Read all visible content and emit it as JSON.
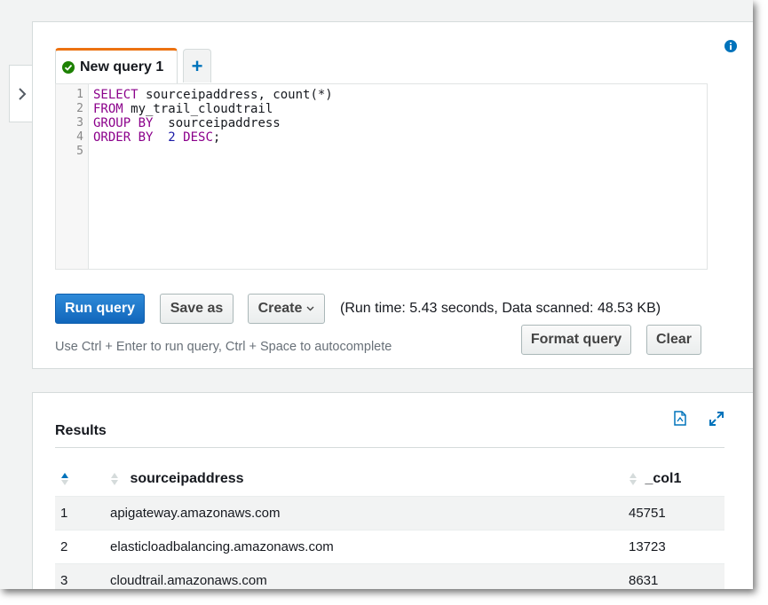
{
  "tab": {
    "label": "New query 1",
    "add_label": "+"
  },
  "editor": {
    "lines": [
      {
        "num": "1",
        "tokens": [
          {
            "t": "SELECT",
            "k": "kw"
          },
          {
            "t": " sourceipaddress, count(*)",
            "k": ""
          }
        ]
      },
      {
        "num": "2",
        "tokens": [
          {
            "t": "FROM",
            "k": "kw"
          },
          {
            "t": " my_trail_cloudtrail",
            "k": ""
          }
        ]
      },
      {
        "num": "3",
        "tokens": [
          {
            "t": "GROUP BY",
            "k": "kw"
          },
          {
            "t": "  sourceipaddress",
            "k": ""
          }
        ]
      },
      {
        "num": "4",
        "tokens": [
          {
            "t": "ORDER BY",
            "k": "kw"
          },
          {
            "t": "  ",
            "k": ""
          },
          {
            "t": "2",
            "k": "num"
          },
          {
            "t": " ",
            "k": ""
          },
          {
            "t": "DESC",
            "k": "kw"
          },
          {
            "t": ";",
            "k": ""
          }
        ]
      },
      {
        "num": "5",
        "tokens": []
      }
    ]
  },
  "actions": {
    "run": "Run query",
    "save_as": "Save as",
    "create": "Create",
    "format": "Format query",
    "clear": "Clear"
  },
  "run_info": "(Run time: 5.43 seconds, Data scanned: 48.53 KB)",
  "hint": "Use Ctrl + Enter to run query, Ctrl + Space to autocomplete",
  "results": {
    "title": "Results",
    "columns": [
      "",
      "sourceipaddress",
      "_col1"
    ],
    "rows": [
      [
        "1",
        "apigateway.amazonaws.com",
        "45751"
      ],
      [
        "2",
        "elasticloadbalancing.amazonaws.com",
        "13723"
      ],
      [
        "3",
        "cloudtrail.amazonaws.com",
        "8631"
      ]
    ]
  },
  "colors": {
    "accent": "#ec7211",
    "primary": "#1166bb",
    "link": "#0073bb",
    "success": "#1d8102"
  }
}
